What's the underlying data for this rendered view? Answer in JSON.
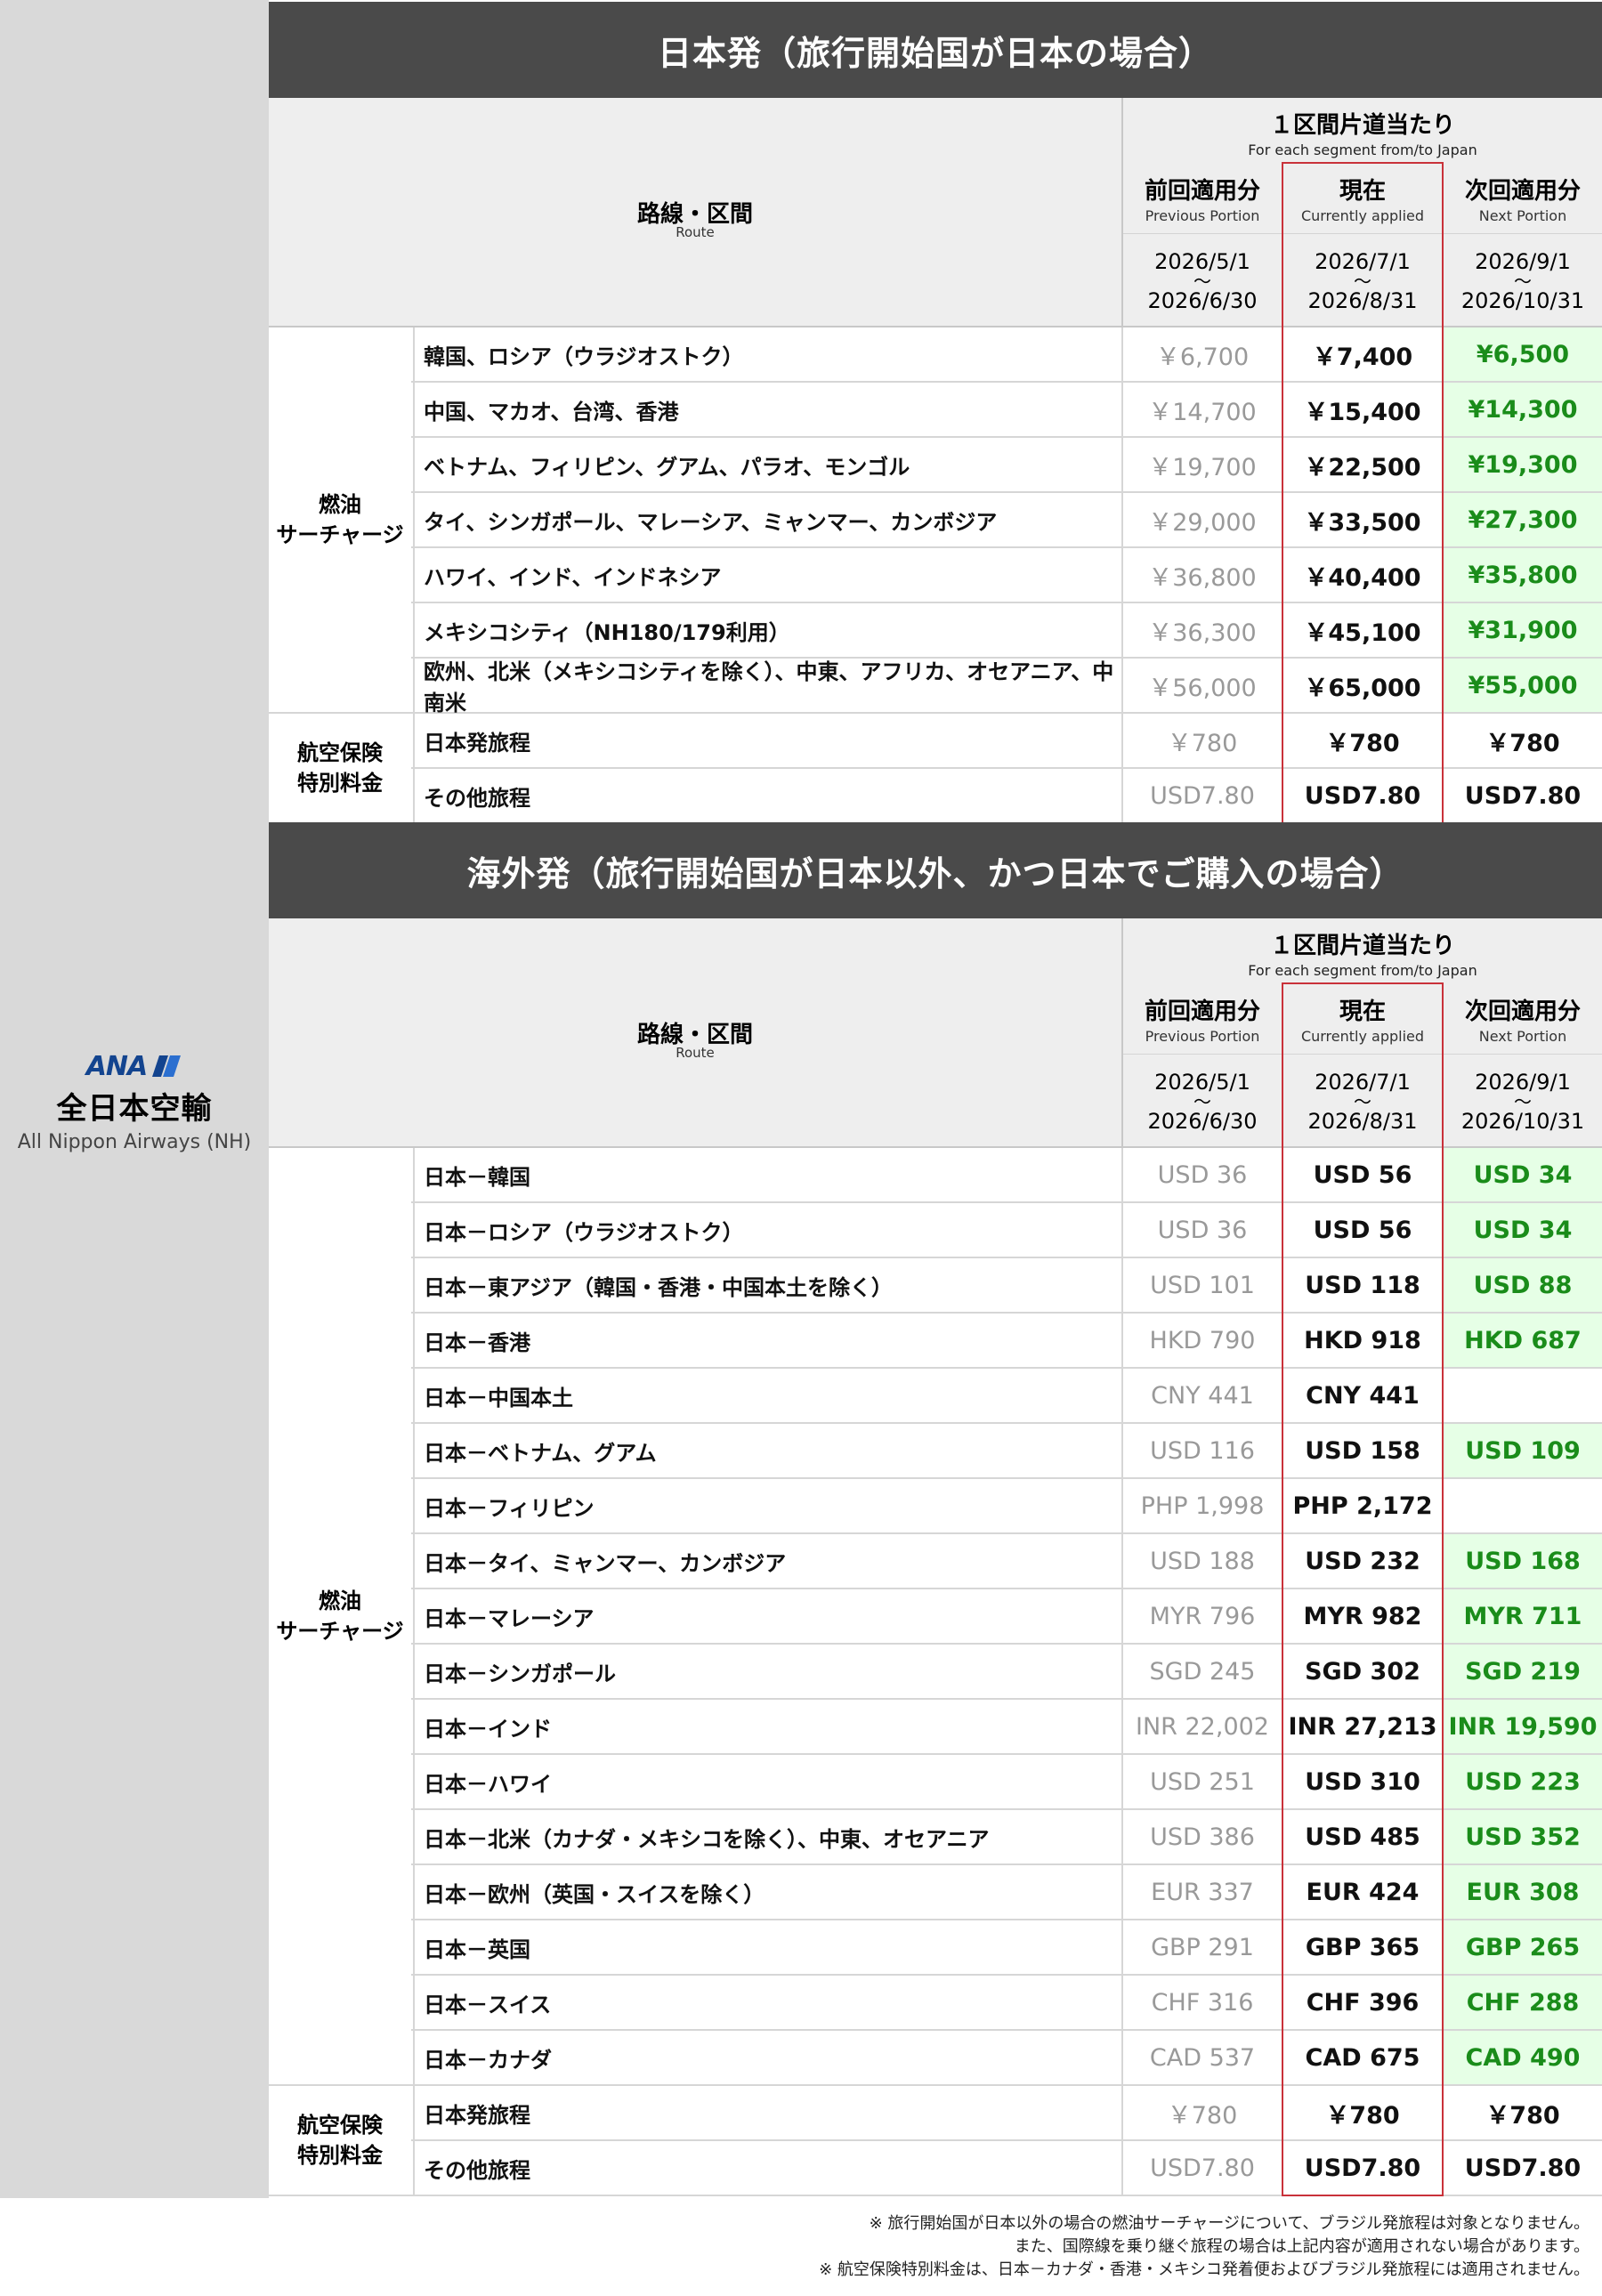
{
  "airline": {
    "logo_text": "ANA",
    "name_ja": "全日本空輸",
    "name_en": "All Nippon Airways (NH)"
  },
  "colors": {
    "banner_bg": "#4a4a4a",
    "current_frame": "#c9323a",
    "next_green_bg": "#e6ffe6",
    "next_green_text": "#1a8c1a",
    "prev_text": "#999999",
    "ana_blue": "#13448f"
  },
  "header": {
    "route_title": "路線・区間",
    "route_sub": "Route",
    "group_title": "１区間片道当たり",
    "group_sub": "For each segment from/to Japan",
    "prev": {
      "title": "前回適用分",
      "sub": "Previous Portion",
      "from": "2026/5/1",
      "tilde": "～",
      "to": "2026/6/30"
    },
    "cur": {
      "title": "現在",
      "sub": "Currently applied",
      "from": "2026/7/1",
      "tilde": "～",
      "to": "2026/8/31"
    },
    "next": {
      "title": "次回適用分",
      "sub": "Next Portion",
      "from": "2026/9/1",
      "tilde": "～",
      "to": "2026/10/31"
    }
  },
  "section1": {
    "banner": "日本発（旅行開始国が日本の場合）",
    "fuel_label": "燃油\nサーチャージ",
    "insurance_label": "航空保険\n特別料金",
    "fuel_rows": [
      {
        "route": "韓国、ロシア（ウラジオストク）",
        "prev": "￥6,700",
        "cur": "￥7,400",
        "next": "¥6,500",
        "green": true
      },
      {
        "route": "中国、マカオ、台湾、香港",
        "prev": "￥14,700",
        "cur": "￥15,400",
        "next": "¥14,300",
        "green": true
      },
      {
        "route": "ベトナム、フィリピン、グアム、パラオ、モンゴル",
        "prev": "￥19,700",
        "cur": "￥22,500",
        "next": "¥19,300",
        "green": true
      },
      {
        "route": "タイ、シンガポール、マレーシア、ミャンマー、カンボジア",
        "prev": "￥29,000",
        "cur": "￥33,500",
        "next": "¥27,300",
        "green": true
      },
      {
        "route": "ハワイ、インド、インドネシア",
        "prev": "￥36,800",
        "cur": "￥40,400",
        "next": "¥35,800",
        "green": true
      },
      {
        "route": "メキシコシティ（NH180/179利用）",
        "prev": "￥36,300",
        "cur": "￥45,100",
        "next": "¥31,900",
        "green": true
      },
      {
        "route": "欧州、北米（メキシコシティを除く）、中東、アフリカ、オセアニア、中南米",
        "prev": "￥56,000",
        "cur": "￥65,000",
        "next": "¥55,000",
        "green": true
      }
    ],
    "insurance_rows": [
      {
        "route": "日本発旅程",
        "prev": "￥780",
        "cur": "￥780",
        "next": "￥780",
        "green": false
      },
      {
        "route": "その他旅程",
        "prev": "USD7.80",
        "cur": "USD7.80",
        "next": "USD7.80",
        "green": false
      }
    ]
  },
  "section2": {
    "banner": "海外発（旅行開始国が日本以外、かつ日本でご購入の場合）",
    "fuel_label": "燃油\nサーチャージ",
    "insurance_label": "航空保険\n特別料金",
    "fuel_rows": [
      {
        "route": "日本－韓国",
        "prev": "USD 36",
        "cur": "USD 56",
        "next": "USD 34",
        "green": true
      },
      {
        "route": "日本－ロシア（ウラジオストク）",
        "prev": "USD 36",
        "cur": "USD 56",
        "next": "USD 34",
        "green": true
      },
      {
        "route": "日本－東アジア（韓国・香港・中国本土を除く）",
        "prev": "USD 101",
        "cur": "USD 118",
        "next": "USD 88",
        "green": true
      },
      {
        "route": "日本－香港",
        "prev": "HKD 790",
        "cur": "HKD 918",
        "next": "HKD 687",
        "green": true
      },
      {
        "route": "日本－中国本土",
        "prev": "CNY 441",
        "cur": "CNY 441",
        "next": "",
        "green": false
      },
      {
        "route": "日本－ベトナム、グアム",
        "prev": "USD 116",
        "cur": "USD 158",
        "next": "USD 109",
        "green": true
      },
      {
        "route": "日本－フィリピン",
        "prev": "PHP 1,998",
        "cur": "PHP 2,172",
        "next": "",
        "green": false
      },
      {
        "route": "日本－タイ、ミャンマー、カンボジア",
        "prev": "USD 188",
        "cur": "USD 232",
        "next": "USD 168",
        "green": true
      },
      {
        "route": "日本－マレーシア",
        "prev": "MYR 796",
        "cur": "MYR 982",
        "next": "MYR 711",
        "green": true
      },
      {
        "route": "日本－シンガポール",
        "prev": "SGD 245",
        "cur": "SGD 302",
        "next": "SGD 219",
        "green": true
      },
      {
        "route": "日本－インド",
        "prev": "INR 22,002",
        "cur": "INR 27,213",
        "next": "INR 19,590",
        "green": true
      },
      {
        "route": "日本－ハワイ",
        "prev": "USD 251",
        "cur": "USD 310",
        "next": "USD 223",
        "green": true
      },
      {
        "route": "日本－北米（カナダ・メキシコを除く）、中東、オセアニア",
        "prev": "USD 386",
        "cur": "USD 485",
        "next": "USD 352",
        "green": true
      },
      {
        "route": "日本－欧州（英国・スイスを除く）",
        "prev": "EUR 337",
        "cur": "EUR 424",
        "next": "EUR 308",
        "green": true
      },
      {
        "route": "日本－英国",
        "prev": "GBP 291",
        "cur": "GBP 365",
        "next": "GBP 265",
        "green": true
      },
      {
        "route": "日本－スイス",
        "prev": "CHF 316",
        "cur": "CHF 396",
        "next": "CHF 288",
        "green": true
      },
      {
        "route": "日本－カナダ",
        "prev": "CAD 537",
        "cur": "CAD 675",
        "next": "CAD 490",
        "green": true
      }
    ],
    "insurance_rows": [
      {
        "route": "日本発旅程",
        "prev": "￥780",
        "cur": "￥780",
        "next": "￥780",
        "green": false
      },
      {
        "route": "その他旅程",
        "prev": "USD7.80",
        "cur": "USD7.80",
        "next": "USD7.80",
        "green": false
      }
    ]
  },
  "notes": [
    "※ 旅行開始国が日本以外の場合の燃油サーチャージについて、ブラジル発旅程は対象となりません。",
    "また、国際線を乗り継ぐ旅程の場合は上記内容が適用されない場合があります。",
    "※ 航空保険特別料金は、日本－カナダ・香港・メキシコ発着便およびブラジル発旅程には適用されません。"
  ]
}
